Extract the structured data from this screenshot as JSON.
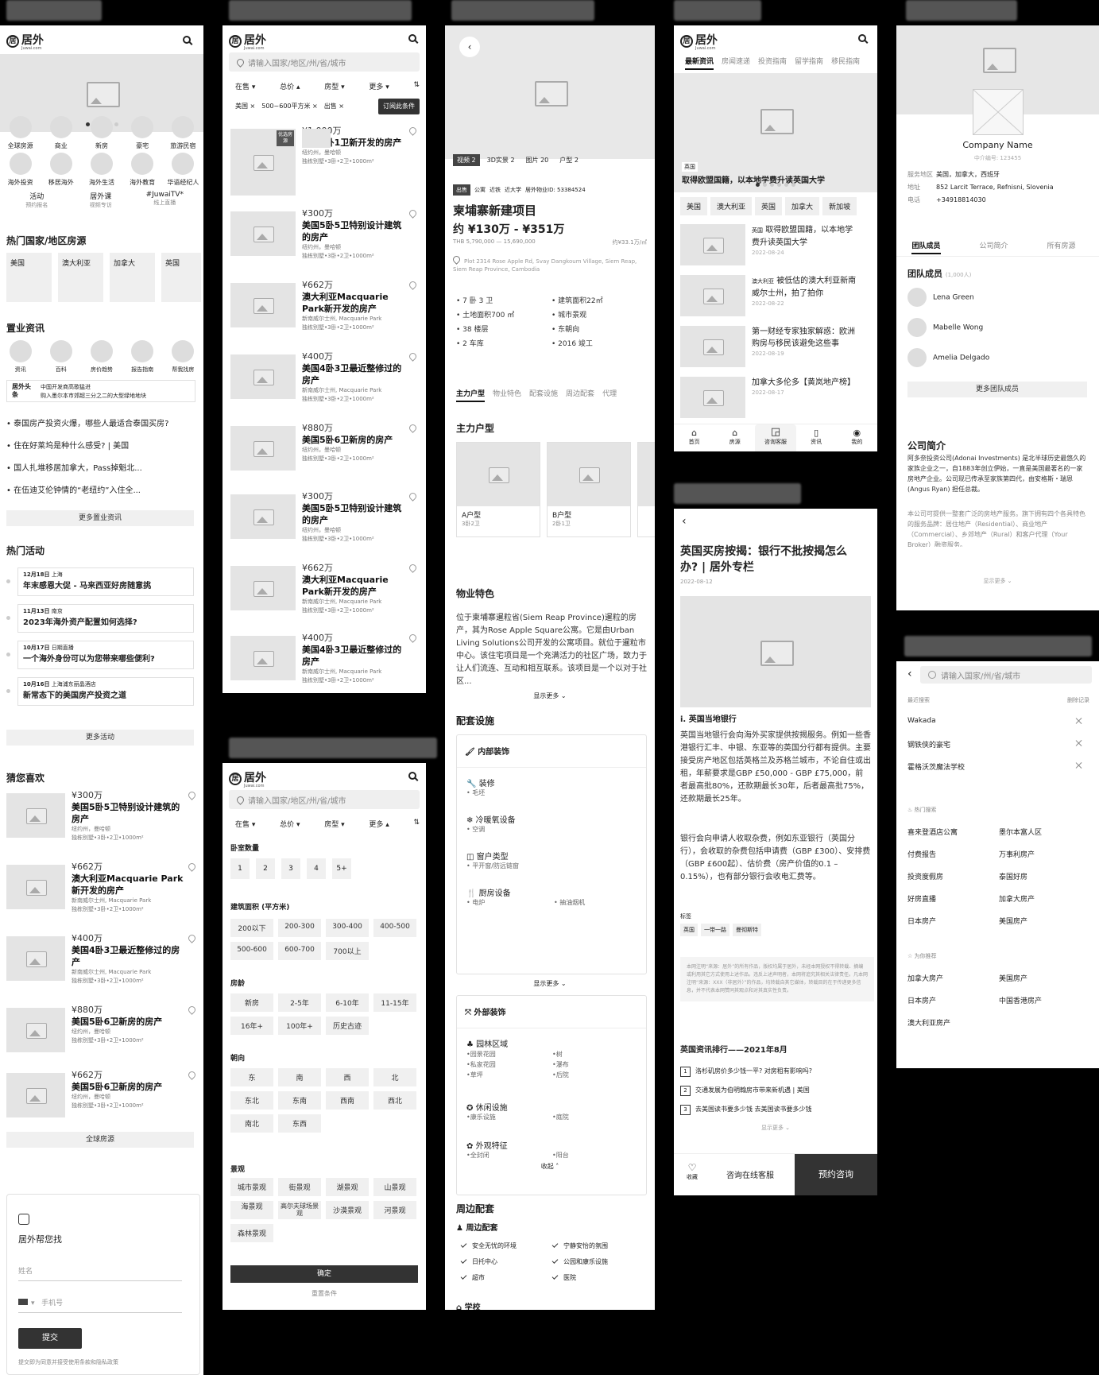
{
  "s1": {
    "logo": "居外",
    "logo_sub": "Juwai.com",
    "icons_row1": [
      "全球房源",
      "商业",
      "新房",
      "豪宅",
      "旅游民宿"
    ],
    "icons_row2": [
      "海外投资",
      "移居海外",
      "海外生活",
      "海外教育",
      "华语经纪人"
    ],
    "quick": [
      {
        "t": "活动",
        "s": "预约报名"
      },
      {
        "t": "居外课",
        "s": "视频专访"
      },
      {
        "t": "#JuwaiTV*",
        "s": "线上直播"
      }
    ],
    "hot_countries_title": "热门国家/地区房源",
    "countries": [
      "美国",
      "澳大利亚",
      "加拿大",
      "英国"
    ],
    "news_title": "置业资讯",
    "news_icons": [
      "资讯",
      "百科",
      "房价趋势",
      "报告指南",
      "帮我找房"
    ],
    "headline_label": "居外头条",
    "headline_1": "中国开发商高歌猛进",
    "headline_2": "购入墨尔本市郊超三分之二的大型绿地地块",
    "news_list": [
      "泰国房产投资火爆，哪些人最适合泰国买房?",
      "住在好莱坞是种什么感受? | 美国",
      "国人扎堆移居加拿大，Pass掉魁北...",
      "在伍迪艾伦钟情的“老纽约”入住全..."
    ],
    "more_news": "更多置业资讯",
    "events_title": "热门活动",
    "events": [
      {
        "d": "12月18日",
        "loc": "上海",
        "t": "年末感恩大促 - 马来西亚好房随意挑"
      },
      {
        "d": "11月13日",
        "loc": "南京",
        "t": "2023年海外资产配置如何选择?"
      },
      {
        "d": "10月17日",
        "loc": "日期直播",
        "t": "一个海外身份可以为您带来哪些便利?"
      },
      {
        "d": "10月16日",
        "loc": "上海浦东丽晶酒店",
        "t": "新常态下的美国房产投资之道"
      }
    ],
    "more_events": "更多活动",
    "guess_title": "猜您喜欢",
    "guess": [
      {
        "p": "¥300万",
        "t": "美国5卧5卫特别设计建筑的房产",
        "l": "纽约州，曼哈顿",
        "s": "独栋别墅•3卧•2卫•1000m²"
      },
      {
        "p": "¥662万",
        "t": "澳大利亚Macquarie Park新开发的房产",
        "l": "新南威尔士州, Macquarie Park",
        "s": "独栋别墅•3卧•2卫•1000m²"
      },
      {
        "p": "¥400万",
        "t": "美国4卧3卫最近整修过的房产",
        "l": "新南威尔士州, Macquarie Park",
        "s": "独栋别墅•3卧•2卫•1000m²"
      },
      {
        "p": "¥880万",
        "t": "美国5卧6卫新房的房产",
        "l": "纽约州，曼哈顿",
        "s": "独栋别墅•3卧•2卫•1000m²"
      },
      {
        "p": "¥662万",
        "t": "美国5卧6卫新房的房产",
        "l": "纽约州，曼哈顿",
        "s": "独栋别墅•3卧•2卫•1000m²"
      }
    ],
    "global": "全球房源",
    "help_title": "居外帮您找",
    "name_ph": "姓名",
    "phone_ph": "手机号",
    "submit": "提交",
    "terms": "提交即为同意并接受使用条款和隐私政策"
  },
  "s2": {
    "search_ph": "请输入国家/地区/州/省/城市",
    "filters": [
      "在售",
      "总价",
      "房型",
      "更多"
    ],
    "tags": [
      "美国",
      "500~600平方米",
      "出售"
    ],
    "subscribe": "订阅此条件",
    "badge": "优选房源",
    "items": [
      {
        "p": "¥1,000万",
        "t": "泰国1卧1卫新开发的房产",
        "l": "纽约州，曼哈顿",
        "s": "独栋别墅•3卧•2卫•1000m²"
      },
      {
        "p": "¥300万",
        "t": "美国5卧5卫特别设计建筑的房产",
        "l": "纽约州，曼哈顿",
        "s": "独栋别墅•3卧•2卫•1000m²"
      },
      {
        "p": "¥662万",
        "t": "澳大利亚Macquarie Park新开发的房产",
        "l": "新南威尔士州, Macquarie Park",
        "s": "独栋别墅•3卧•2卫•1000m²"
      },
      {
        "p": "¥400万",
        "t": "美国4卧3卫最近整修过的房产",
        "l": "新南威尔士州, Macquarie Park",
        "s": "独栋别墅•3卧•2卫•1000m²"
      },
      {
        "p": "¥880万",
        "t": "美国5卧6卫新房的房产",
        "l": "纽约州，曼哈顿",
        "s": "独栋别墅•3卧•2卫•1000m²"
      },
      {
        "p": "¥300万",
        "t": "美国5卧5卫特别设计建筑的房产",
        "l": "纽约州，曼哈顿",
        "s": "独栋别墅•3卧•2卫•1000m²"
      },
      {
        "p": "¥662万",
        "t": "澳大利亚Macquarie Park新开发的房产",
        "l": "新南威尔士州, Macquarie Park",
        "s": "独栋别墅•3卧•2卫•1000m²"
      },
      {
        "p": "¥400万",
        "t": "美国4卧3卫最近整修过的房产",
        "l": "新南威尔士州, Macquarie Park",
        "s": "独栋别墅•3卧•2卫•1000m²"
      }
    ]
  },
  "s3": {
    "media": [
      {
        "t": "视频",
        "n": "2"
      },
      {
        "t": "3D实景",
        "n": "2"
      },
      {
        "t": "图片",
        "n": "20"
      },
      {
        "t": "户型",
        "n": "2"
      }
    ],
    "tags": [
      "出售",
      "公寓",
      "近铁",
      "近大学"
    ],
    "pid": "居外物业ID: 53384524",
    "title": "柬埔寨新建项目",
    "price": "约 ¥130万 - ¥351万",
    "price_thb": "THB 5,790,000 — 15,690,000",
    "unit": "约¥33.1万/㎡",
    "addr": "Plot 2314 Rose Apple Rd, Svay Dangkoum Village, Siem Reap, Siem Reap Province, Cambodia",
    "facts_l": [
      "7 卧 3 卫",
      "土地面积700 ㎡",
      "38 楼层",
      "2 车库"
    ],
    "facts_r": [
      "建筑面积22㎡",
      "城市景观",
      "东朝向",
      "2016 竣工"
    ],
    "tabs": [
      "主力户型",
      "物业特色",
      "配套设施",
      "周边配套",
      "代理"
    ],
    "layouts_title": "主力户型",
    "layouts": [
      {
        "t": "A户型",
        "s": "3卧2卫"
      },
      {
        "t": "B户型",
        "s": "2卧1卫"
      }
    ],
    "feature_title": "物业特色",
    "feature_text": "位于柬埔寨暹粒省(Siem Reap Province)暹粒的房产，其为Rose Apple Square公寓。它是由Urban Living Solutions公司开发的公寓项目。就位于暹粒市中心。该住宅项目是一个充满活力的社区广场，致力于让人们流连、互动和相互联系。该项目是一个以对于社区...",
    "show_more": "显示更多",
    "fac_title": "配套设施",
    "fac_inner": "内部装饰",
    "fac_items": [
      {
        "t": "装修",
        "s": "毛坯"
      },
      {
        "t": "冷暖氧设备",
        "s": "空调"
      },
      {
        "t": "窗户类型",
        "s": "平开窗/防远链窗"
      },
      {
        "t": "厨房设备",
        "s": "电炉",
        "s2": "抽油烟机"
      }
    ],
    "fac_outer": "外部装饰",
    "garden": "园林区域",
    "garden_items": [
      "园景花园",
      "私家花园",
      "草坪",
      "树",
      "瀑布",
      "后院"
    ],
    "leisure": "休闲设施",
    "leisure_items": [
      "康乐设施",
      "庭院"
    ],
    "appearance": "外观特征",
    "appearance_items": [
      "全封闭",
      "阳台"
    ],
    "collapse": "收起",
    "around_title": "周边配套",
    "around_sub": "周边配套",
    "around_items": [
      "安全无忧的环境",
      "宁静安怡的氛围",
      "日托中心",
      "公园和康乐设施",
      "超市",
      "医院"
    ],
    "school": "学校"
  },
  "s4": {
    "tabs": [
      "最新资讯",
      "房闻速递",
      "投资指南",
      "留学指南",
      "移民指南"
    ],
    "banner_tag": "英国",
    "banner_title": "取得欧盟国籍，以本地学费升读英国大学",
    "chips": [
      "美国",
      "澳大利亚",
      "英国",
      "加拿大",
      "新加坡"
    ],
    "items": [
      {
        "tag": "英国",
        "t": "取得欧盟国籍，以本地学费升读英国大学",
        "d": "2022-08-24"
      },
      {
        "tag": "澳大利亚",
        "t": "被低估的澳大利亚新南威尔士州，拍了拍你",
        "d": "2022-08-22"
      },
      {
        "tag": "",
        "t": "第一财经专家独家解惑：欧洲购房与移民该避免这些事",
        "d": "2022-08-19"
      },
      {
        "tag": "",
        "t": "加拿大多伦多【黄岚地产榜】",
        "d": "2022-08-17"
      }
    ],
    "nav": [
      "首页",
      "房源",
      "咨询客服",
      "资讯",
      "我的"
    ]
  },
  "s5": {
    "title": "英国买房按揭：银行不批按揭怎么办? | 居外专栏",
    "date": "2022-08-12",
    "h": "i. 英国当地银行",
    "p1": "英国当地银行会向海外买家提供按揭服务。例如一些香港银行汇丰、中银、东亚等的英国分行都有提供。主要接受房产地区包括英格兰及苏格兰城市，不论自住或出租，年薪要求是GBP £50,000 - GBP £75,000，前者最高批80%，还款期最长30年，后者最高批75%，还款期最长25年。",
    "p2": "银行会向申请人收取杂费，例如东亚银行（英国分行），会收取的杂费包括申请费（GBP £300）、安排费（GBP £600起）、估价费（房产价值的0.1 – 0.15%），也有部分银行会收电汇费等。",
    "tags_label": "标签",
    "tags": [
      "英国",
      "一带一路",
      "曼彻斯特"
    ],
    "copyright": "本网注明“来源：居外”的所有作品，版权均属于居外，未经本网授权不得转载、摘编或利用其它方式使用上述作品。违反上述声明者，本网将追究其相关法律责任。凡本网注明“来源：XXX（非居外）”的作品，均转载自其它媒体，转载目的在于传递更多信息，并不代表本网赞同其观点和对其真实性负责。",
    "rank_title": "英国资讯排行——2021年8月",
    "rank": [
      "洛杉矶房价多少钱一平? 对房租有影响吗?",
      "交通发展为伯明翰房市带来新机遇 | 美国",
      "去美国读书要多少钱 去美国读书要多少钱"
    ],
    "show_more": "显示更多",
    "fav": "收藏",
    "consult": "咨询在线客服",
    "book": "预约咨询"
  },
  "s6": {
    "company": "Company Name",
    "agent_no": "中介编号: 123455",
    "info": [
      {
        "k": "服务地区",
        "v": "美国，加拿大，西班牙"
      },
      {
        "k": "地址",
        "v": "852 Larcit Terrace, Refnisni, Slovenia"
      },
      {
        "k": "电话",
        "v": "+34918814030"
      }
    ],
    "tabs": [
      "团队成员",
      "公司简介",
      "所有房源"
    ],
    "team_title": "团队成员",
    "team_count": "(1,000人)",
    "members": [
      "Lena Green",
      "Mabelle Wong",
      "Amelia Delgado"
    ],
    "more_team": "更多团队成员",
    "intro_title": "公司简介",
    "intro1": "阿多奈投资公司(Adonai Investments) 是北半球历史最悠久的家族企业之一，自1883年创立伊始，一直是美国最著名的一家房地产企业。公司现已传承至家族第四代，由安格斯・瑞恩 (Angus Ryan) 担任总裁。",
    "intro2": "本公司可提供一整套广泛的房地产服务。旗下拥有四个各具特色的服务品牌：居住地产（Residential）、商业地产（Commercial）、乡郊地产（Rural）和客户代理（Your Broker）融资服务。",
    "show_more": "显示更多"
  },
  "s7": {
    "search_ph": "请输入国家/州/省/城市",
    "recent": "最近搜索",
    "clear": "删除记录",
    "recent_items": [
      "Wakada",
      "钢铁侠的豪宅",
      "霍格沃茨魔法学校"
    ],
    "hot": "热门搜索",
    "hot_items": [
      "喜来登酒店公寓",
      "墨尔本富人区",
      "付费报告",
      "万事利房产",
      "投资度假房",
      "泰国好房",
      "好房直播",
      "加拿大房产",
      "日本房产",
      "美国房产"
    ],
    "rec": "为你推荐",
    "rec_items": [
      "加拿大房产",
      "美国房产",
      "日本房产",
      "中国香港房产",
      "澳大利亚房产"
    ]
  },
  "s8": {
    "search_ph": "请输入国家/地区/州/省/城市",
    "filters": [
      "在售",
      "总价",
      "房型",
      "更多"
    ],
    "bed_title": "卧室数量",
    "beds": [
      "1",
      "2",
      "3",
      "4",
      "5+"
    ],
    "area_title": "建筑面积 (平方米)",
    "areas": [
      "200以下",
      "200-300",
      "300-400",
      "400-500",
      "500-600",
      "600-700",
      "700以上"
    ],
    "age_title": "房龄",
    "ages": [
      "新房",
      "2-5年",
      "6-10年",
      "11-15年",
      "16年+",
      "100年+",
      "历史古迹"
    ],
    "dir_title": "朝向",
    "dirs": [
      "东",
      "南",
      "西",
      "北",
      "东北",
      "东南",
      "西南",
      "西北",
      "南北",
      "东西"
    ],
    "view_title": "景观",
    "views": [
      "城市景观",
      "街景观",
      "湖景观",
      "山景观",
      "海景观",
      "高尔夫球场景观",
      "沙漠景观",
      "河景观",
      "森林景观"
    ],
    "confirm": "确定",
    "reset": "重置条件"
  }
}
